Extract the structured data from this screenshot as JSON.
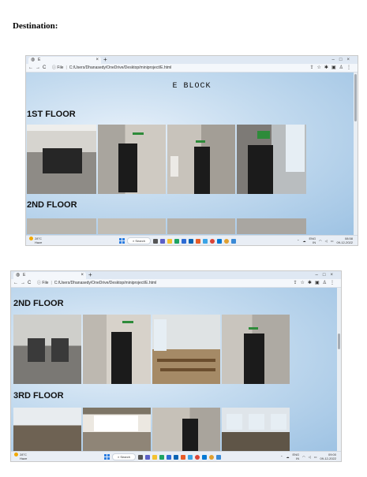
{
  "document": {
    "heading": "Destination:"
  },
  "browser": {
    "tab_favicon": "globe-icon",
    "tab_title": "E",
    "tab_close": "×",
    "new_tab": "+",
    "window_controls": [
      "–",
      "□",
      "×"
    ],
    "nav_icons": [
      "←",
      "→",
      "C"
    ],
    "file_label": "File",
    "url": "C:/Users/Dhanasedy/OneDrive/Desktop/miniproject/E.html",
    "toolbar_icons": [
      "share-icon",
      "star-icon",
      "extensions-icon",
      "sidebar-icon",
      "profile-icon",
      "menu-icon"
    ]
  },
  "screenshot1": {
    "page_title": "E BLOCK",
    "floor_a": "1ST FLOOR",
    "floor_b": "2ND FLOOR"
  },
  "screenshot2": {
    "floor_a": "2ND FLOOR",
    "floor_b": "3RD FLOOR"
  },
  "taskbar": {
    "weather_temp": "28°C",
    "weather_desc": "Haze",
    "search_label": "Search",
    "lang_primary": "ENG",
    "lang_secondary": "IN",
    "shot1_time": "08:58",
    "shot1_date": "09-12-2022",
    "shot2_time": "09:00",
    "shot2_date": "09-12-2022"
  },
  "colors": {
    "page_sky": "#c4dbef",
    "tab_bar": "#dfe8f3",
    "exit_sign": "#2e8b3a",
    "door": "#1b1b1b"
  }
}
